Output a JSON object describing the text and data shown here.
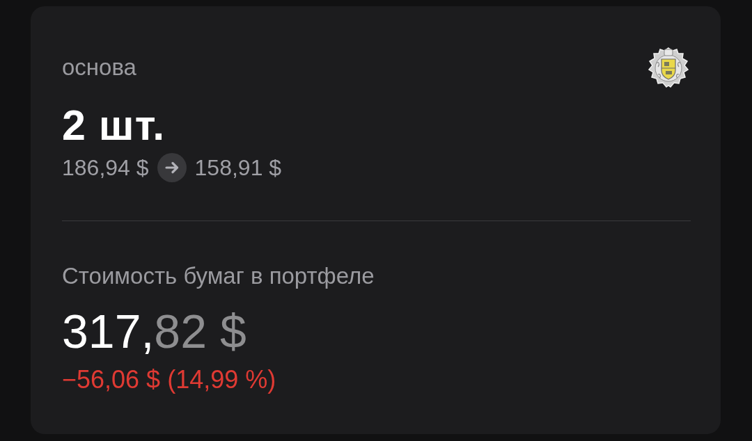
{
  "card": {
    "title": "основа",
    "quantity": "2 шт.",
    "price_from": "186,94 $",
    "price_to": "158,91 $"
  },
  "portfolio": {
    "label": "Стоимость бумаг в портфеле",
    "value_whole": "317,",
    "value_fraction": "82 $",
    "change": "−56,06 $ (14,99 %)",
    "change_negative": true
  }
}
